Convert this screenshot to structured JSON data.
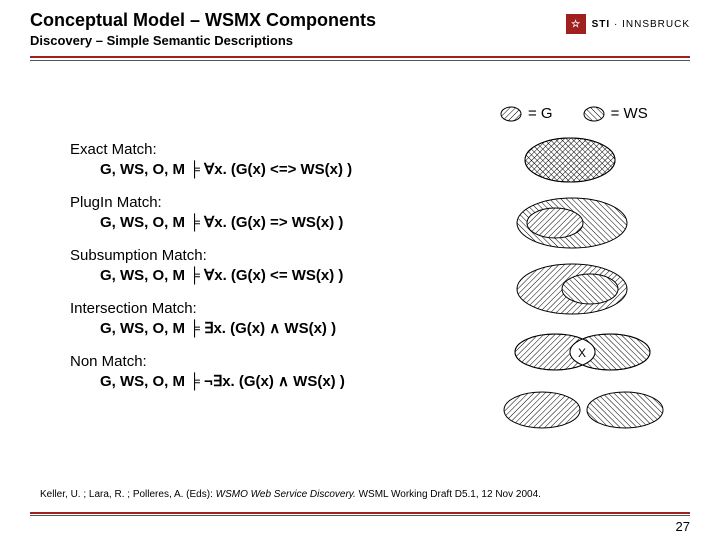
{
  "header": {
    "title": "Conceptual Model – WSMX Components",
    "subtitle": "Discovery – Simple Semantic Descriptions"
  },
  "logo": {
    "mark": "☆",
    "brand": "STI",
    "sep": "·",
    "org": "INNSBRUCK"
  },
  "legend": {
    "g": "= G",
    "ws": "= WS"
  },
  "matches": [
    {
      "title": "Exact Match:",
      "formula": "G, WS, O, M ╞ ∀x. (G(x) <=> WS(x) )"
    },
    {
      "title": "PlugIn Match:",
      "formula": "G, WS, O, M ╞ ∀x. (G(x) => WS(x) )"
    },
    {
      "title": "Subsumption Match:",
      "formula": "G, WS, O, M ╞ ∀x. (G(x) <= WS(x) )"
    },
    {
      "title": "Intersection Match:",
      "formula": "G, WS, O, M ╞ ∃x. (G(x) ∧ WS(x) )"
    },
    {
      "title": "Non Match:",
      "formula": "G, WS, O, M ╞ ¬∃x. (G(x) ∧ WS(x) )"
    }
  ],
  "intersection_label": "X",
  "citation": {
    "authors": "Keller, U. ; Lara, R. ; Polleres, A. (Eds): ",
    "work": "WSMO Web Service Discovery.",
    "rest": " WSML Working Draft D5.1, 12 Nov 2004."
  },
  "page_number": "27"
}
